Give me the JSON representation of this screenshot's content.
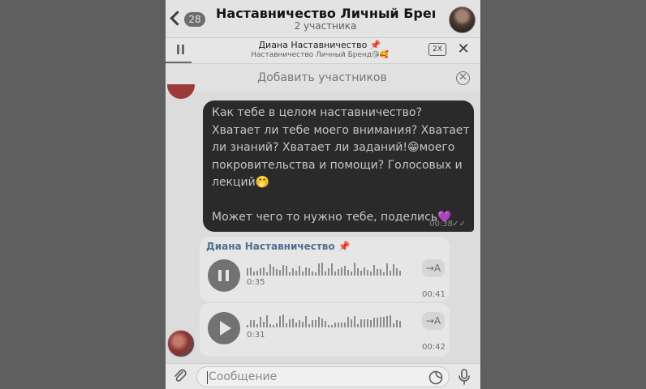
{
  "header": {
    "back_count": "28",
    "title": "Наставничество Личный Бренд...",
    "subtitle": "2 участника"
  },
  "player": {
    "track_name": "Диана Наставничество 📌",
    "chat_name": "Наставничество Личный Бренд😘🥰",
    "speed": "2X",
    "close": "✕"
  },
  "addbar": {
    "label": "Добавить участников",
    "close": "✕"
  },
  "messages": {
    "outgoing": {
      "text": "Как тебе в целом наставничество? Хватает ли тебе моего внимания? Хватает ли знаний? Хватает ли заданий!😁моего покровительства и помощи? Голосовых и лекций🤭\n\nМожет чего то нужно тебе, поделись💜",
      "time": "00:38",
      "status_icon": "✓✓"
    },
    "voice1": {
      "sender": "Диана Наставничество 📌",
      "elapsed": "0:35",
      "time": "00:41",
      "transcribe_icon": "→A",
      "state": "playing"
    },
    "voice2": {
      "elapsed": "0:31",
      "time": "00:42",
      "transcribe_icon": "→A",
      "state": "paused"
    }
  },
  "input": {
    "placeholder": "Сообщение"
  },
  "icons": {
    "back": "chevron-left-icon",
    "attach": "paperclip-icon",
    "sticker": "sticker-icon",
    "mic": "microphone-icon"
  },
  "colors": {
    "outgoing_bubble": "#2a2a2a",
    "incoming_bubble": "#e6e6e6",
    "sender_name": "#4f6f8f",
    "backdrop": "#5f5f5f"
  }
}
